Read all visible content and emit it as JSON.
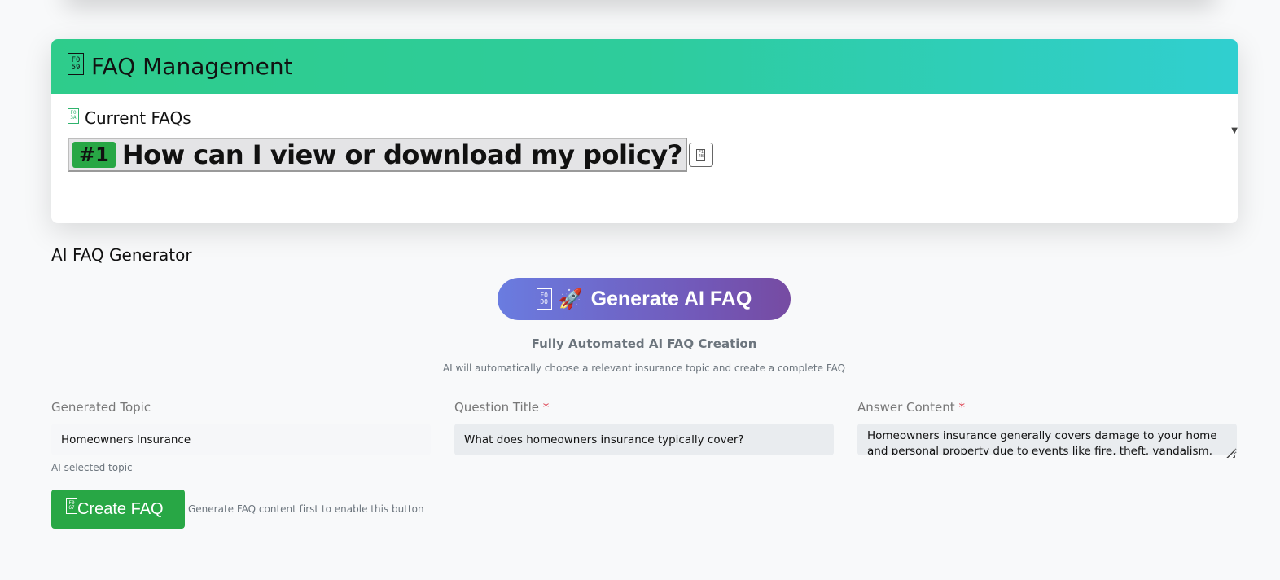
{
  "faq_management": {
    "header_icon": "F059",
    "title": "FAQ Management",
    "current_icon": "F03A",
    "current_title": "Current FAQs",
    "faqs": [
      {
        "badge": "#1",
        "question": "How can I view or download my policy?",
        "action_icon": "F14B"
      }
    ]
  },
  "generator": {
    "section_title": "AI FAQ Generator",
    "button_icon": "F0D0",
    "button_emoji": "🚀",
    "button_label": "Generate AI FAQ",
    "subtitle": "Fully Automated AI FAQ Creation",
    "description": "AI will automatically choose a relevant insurance topic and create a complete FAQ"
  },
  "form": {
    "topic_label": "Generated Topic",
    "topic_value": "Homeowners Insurance",
    "topic_help": "AI selected topic",
    "question_label": "Question Title",
    "question_value": "What does homeowners insurance typically cover?",
    "answer_label": "Answer Content",
    "answer_value": "Homeowners insurance generally covers damage to your home and personal property due to events like fire, theft, vandalism, and certain natural disasters.",
    "required_mark": "*"
  },
  "create": {
    "icon": "F067",
    "label": "Create FAQ",
    "note": "Generate FAQ content first to enable this button"
  },
  "colors": {
    "header_gradient_start": "#2ecc8b",
    "header_gradient_end": "#30cfd0",
    "generate_gradient_start": "#6a7ce0",
    "generate_gradient_end": "#764ba2",
    "success": "#28a745",
    "required": "#dc3545"
  }
}
